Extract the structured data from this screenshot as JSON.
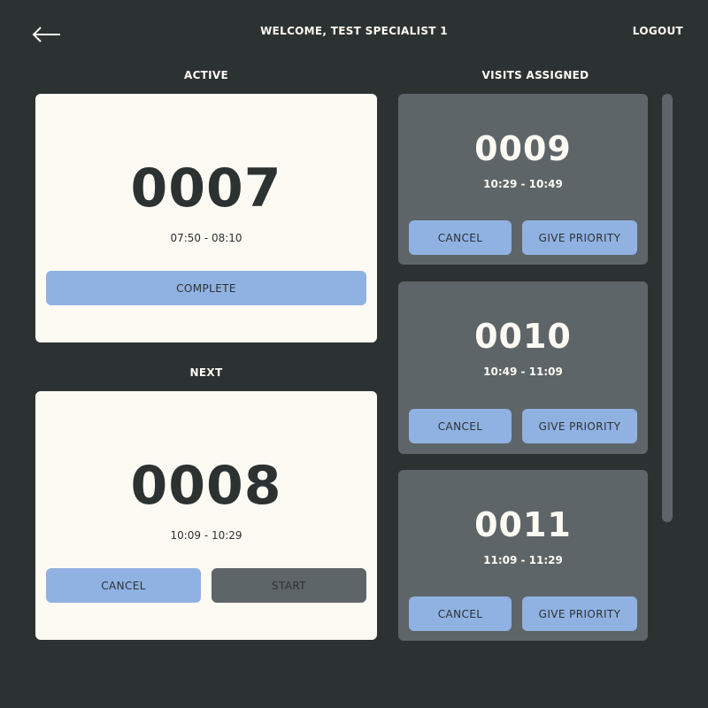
{
  "header": {
    "welcome": "WELCOME, TEST SPECIALIST 1",
    "logout_label": "LOGOUT",
    "back_icon": "arrow-left-icon"
  },
  "active": {
    "title": "ACTIVE",
    "number": "0007",
    "time": "07:50 - 08:10",
    "complete_label": "COMPLETE"
  },
  "next": {
    "title": "NEXT",
    "number": "0008",
    "time": "10:09 - 10:29",
    "cancel_label": "CANCEL",
    "start_label": "START"
  },
  "visits": {
    "title": "VISITS ASSIGNED",
    "items": [
      {
        "number": "0009",
        "time": "10:29 - 10:49",
        "cancel_label": "CANCEL",
        "priority_label": "GIVE PRIORITY"
      },
      {
        "number": "0010",
        "time": "10:49 - 11:09",
        "cancel_label": "CANCEL",
        "priority_label": "GIVE PRIORITY"
      },
      {
        "number": "0011",
        "time": "11:09 - 11:29",
        "cancel_label": "CANCEL",
        "priority_label": "GIVE PRIORITY"
      }
    ]
  },
  "colors": {
    "background": "#2c3131",
    "card_light": "#fdfaf3",
    "card_dark": "#5e6568",
    "button_blue": "#90b2e2",
    "button_disabled": "#5e6568"
  }
}
